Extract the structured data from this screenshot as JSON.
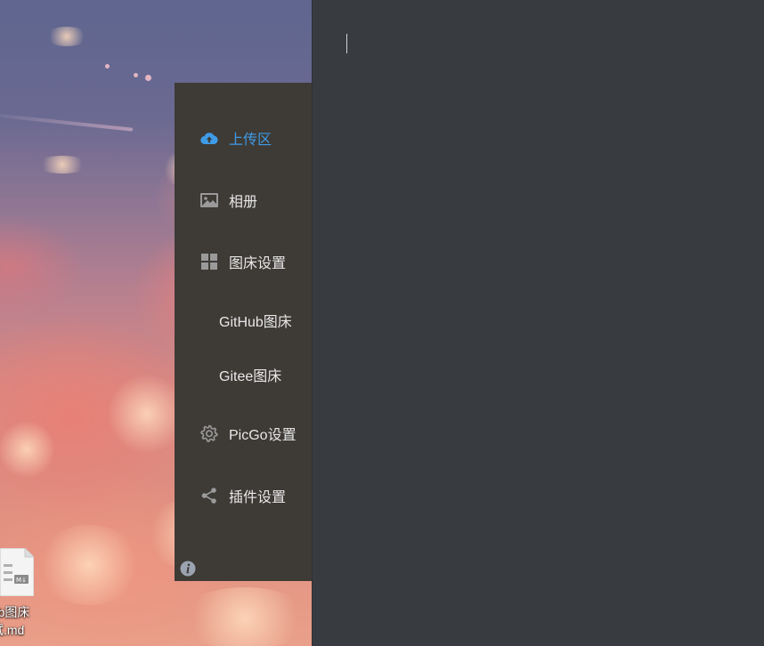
{
  "desktop": {
    "file": {
      "icon": "markdown-file-icon",
      "name_line1": "hub图床",
      "name_line2": "试.md"
    }
  },
  "sidebar": {
    "items": [
      {
        "label": "上传区",
        "icon": "cloud-upload-icon",
        "active": true
      },
      {
        "label": "相册",
        "icon": "image-icon"
      },
      {
        "label": "图床设置",
        "icon": "grid-icon"
      },
      {
        "label": "PicGo设置",
        "icon": "gear-icon"
      },
      {
        "label": "插件设置",
        "icon": "share-icon"
      }
    ],
    "subitems": [
      {
        "label": "GitHub图床"
      },
      {
        "label": "Gitee图床"
      }
    ],
    "info_icon": "info-icon"
  },
  "colors": {
    "accent": "#3e9be6",
    "sidebar_bg": "#3e3a36",
    "panel_bg": "#383b40",
    "text": "#e8e8e8",
    "icon_gray": "#9a9a9a"
  }
}
